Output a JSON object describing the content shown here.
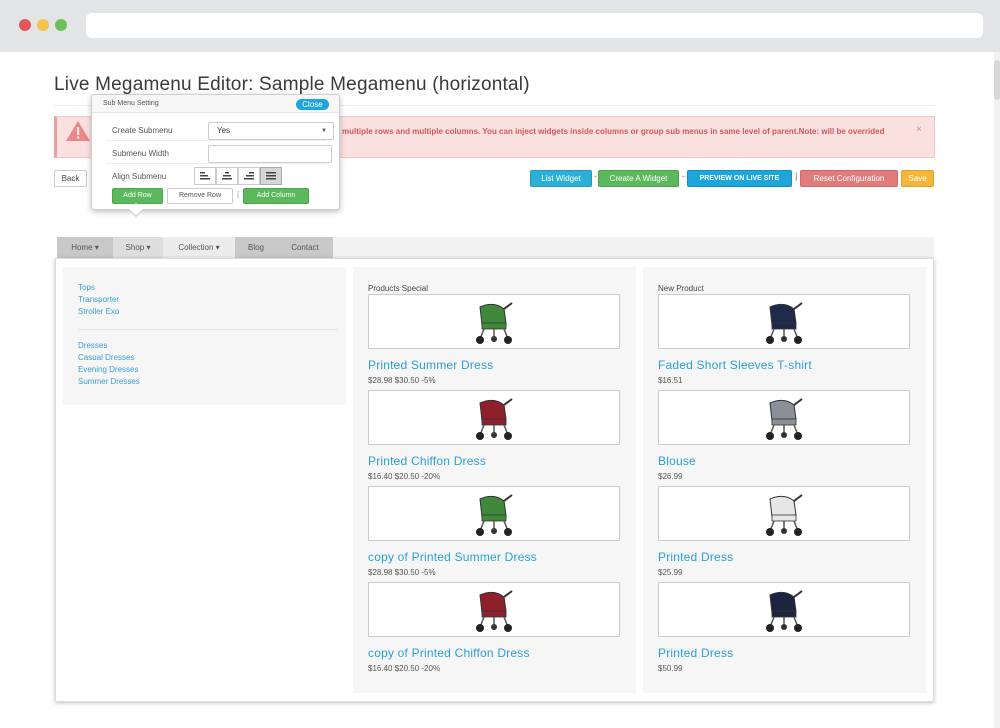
{
  "page": {
    "title": "Live Megamenu Editor: Sample Megamenu (horizontal)"
  },
  "alert": {
    "text": "multiple rows and multiple columns. You can inject widgets inside columns or group sub menus in same level of parent.Note: will be overrided",
    "close": "×"
  },
  "toolbar": {
    "back": "Back",
    "list_widget": "List Widget",
    "create_widget": "Create A Widget",
    "preview": "PREVIEW ON LIVE SITE",
    "reset": "Reset Configuration",
    "save": "Save",
    "sep_dash": "-",
    "sep_bar": "|"
  },
  "popup": {
    "title": "Sub Menu Setting",
    "close": "Close",
    "create_submenu_label": "Create Submenu",
    "create_submenu_value": "Yes",
    "submenu_width_label": "Submenu Width",
    "submenu_width_value": "",
    "align_submenu_label": "Align Submenu",
    "add_row": "Add Row",
    "remove_row": "Remove Row",
    "sep": "|",
    "add_column": "Add Column"
  },
  "menu": {
    "items": [
      "Home ▾",
      "Shop ▾",
      "Collection ▾",
      "Blog",
      "Contact"
    ]
  },
  "categories": {
    "group1": [
      "Tops",
      "Transporter",
      "Stroller Exo"
    ],
    "group2": [
      "Dresses",
      "Casual Dresses",
      "Evening Dresses",
      "Summer Dresses"
    ]
  },
  "products_special": {
    "title": "Products Special",
    "items": [
      {
        "name": "Printed Summer Dress",
        "price": "$28.98 $30.50 -5%",
        "color": "#3f8a3a"
      },
      {
        "name": "Printed Chiffon Dress",
        "price": "$16.40 $20.50 -20%",
        "color": "#8e1f2b"
      },
      {
        "name": "copy of Printed Summer Dress",
        "price": "$28.98 $30.50 -5%",
        "color": "#3f8a3a"
      },
      {
        "name": "copy of Printed Chiffon Dress",
        "price": "$16.40 $20.50 -20%",
        "color": "#8e1f2b"
      }
    ]
  },
  "new_product": {
    "title": "New Product",
    "items": [
      {
        "name": "Faded Short Sleeves T-shirt",
        "price": "$16.51",
        "color": "#1f2a4a"
      },
      {
        "name": "Blouse",
        "price": "$26.99",
        "color": "#8a8f98"
      },
      {
        "name": "Printed Dress",
        "price": "$25.99",
        "color": "#e6e6e6"
      },
      {
        "name": "Printed Dress",
        "price": "$50.99",
        "color": "#1c2440"
      }
    ]
  }
}
